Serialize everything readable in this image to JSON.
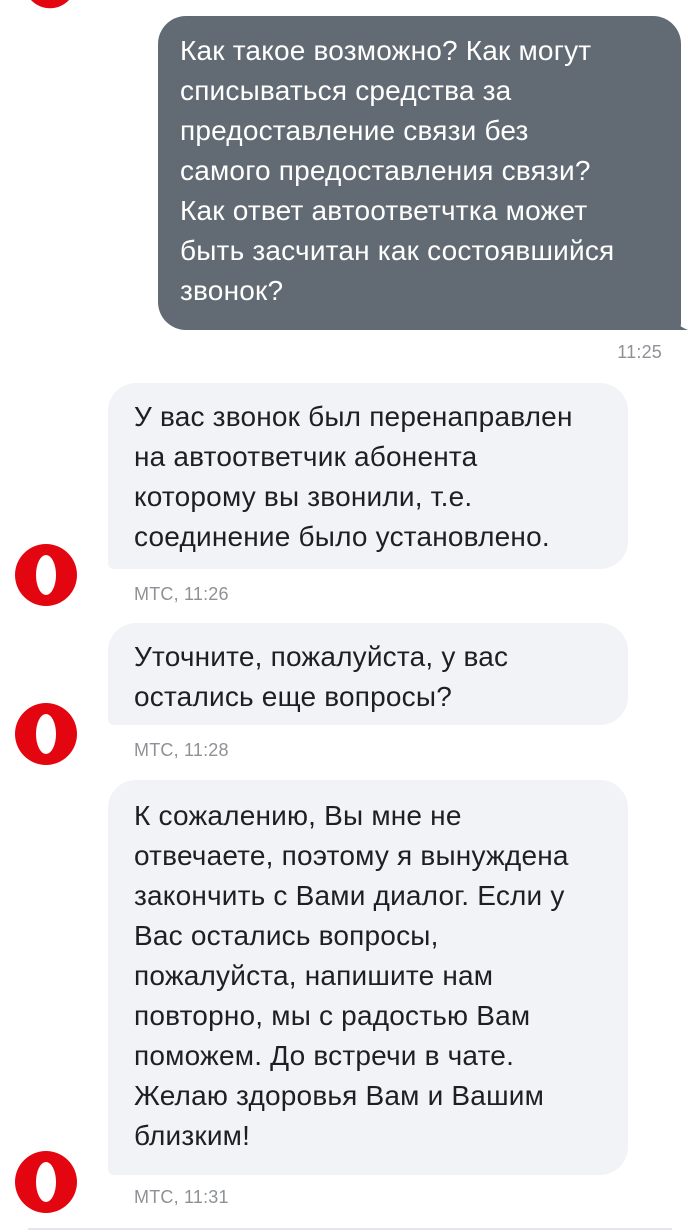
{
  "chat": {
    "messages": [
      {
        "from": "user",
        "text": "Как такое возможно? Как могут\nсписываться средства за\nпредоставление связи без\nсамого предоставления связи?\nКак ответ автоответчтка может\nбыть засчитан как состоявшийся\nзвонок?",
        "time": "11:25"
      },
      {
        "from": "operator",
        "text": "У вас звонок был перенаправлен\nна автоответчик абонента\nкоторому вы звонили, т.е.\nсоединение было установлено.",
        "meta": "МТС, 11:26"
      },
      {
        "from": "operator",
        "text": "Уточните, пожалуйста, у вас\nостались еще вопросы?",
        "meta": "МТС, 11:28"
      },
      {
        "from": "operator",
        "text": "К сожалению, Вы мне не\nотвечаете, поэтому я вынуждена\nзакончить с Вами диалог. Если у\nВас остались вопросы,\nпожалуйста, напишите нам\nповторно, мы с радостью Вам\nпоможем. До встречи в чате.\nЖелаю здоровья Вам и Вашим\nблизким!",
        "meta": "МТС, 11:31"
      }
    ]
  },
  "colors": {
    "user_bubble": "#626b73",
    "operator_bubble": "#f2f3f7",
    "brand_red": "#e30611",
    "meta_text": "#8e9196"
  },
  "icons": {
    "operator_avatar": "mts-logo-icon"
  }
}
